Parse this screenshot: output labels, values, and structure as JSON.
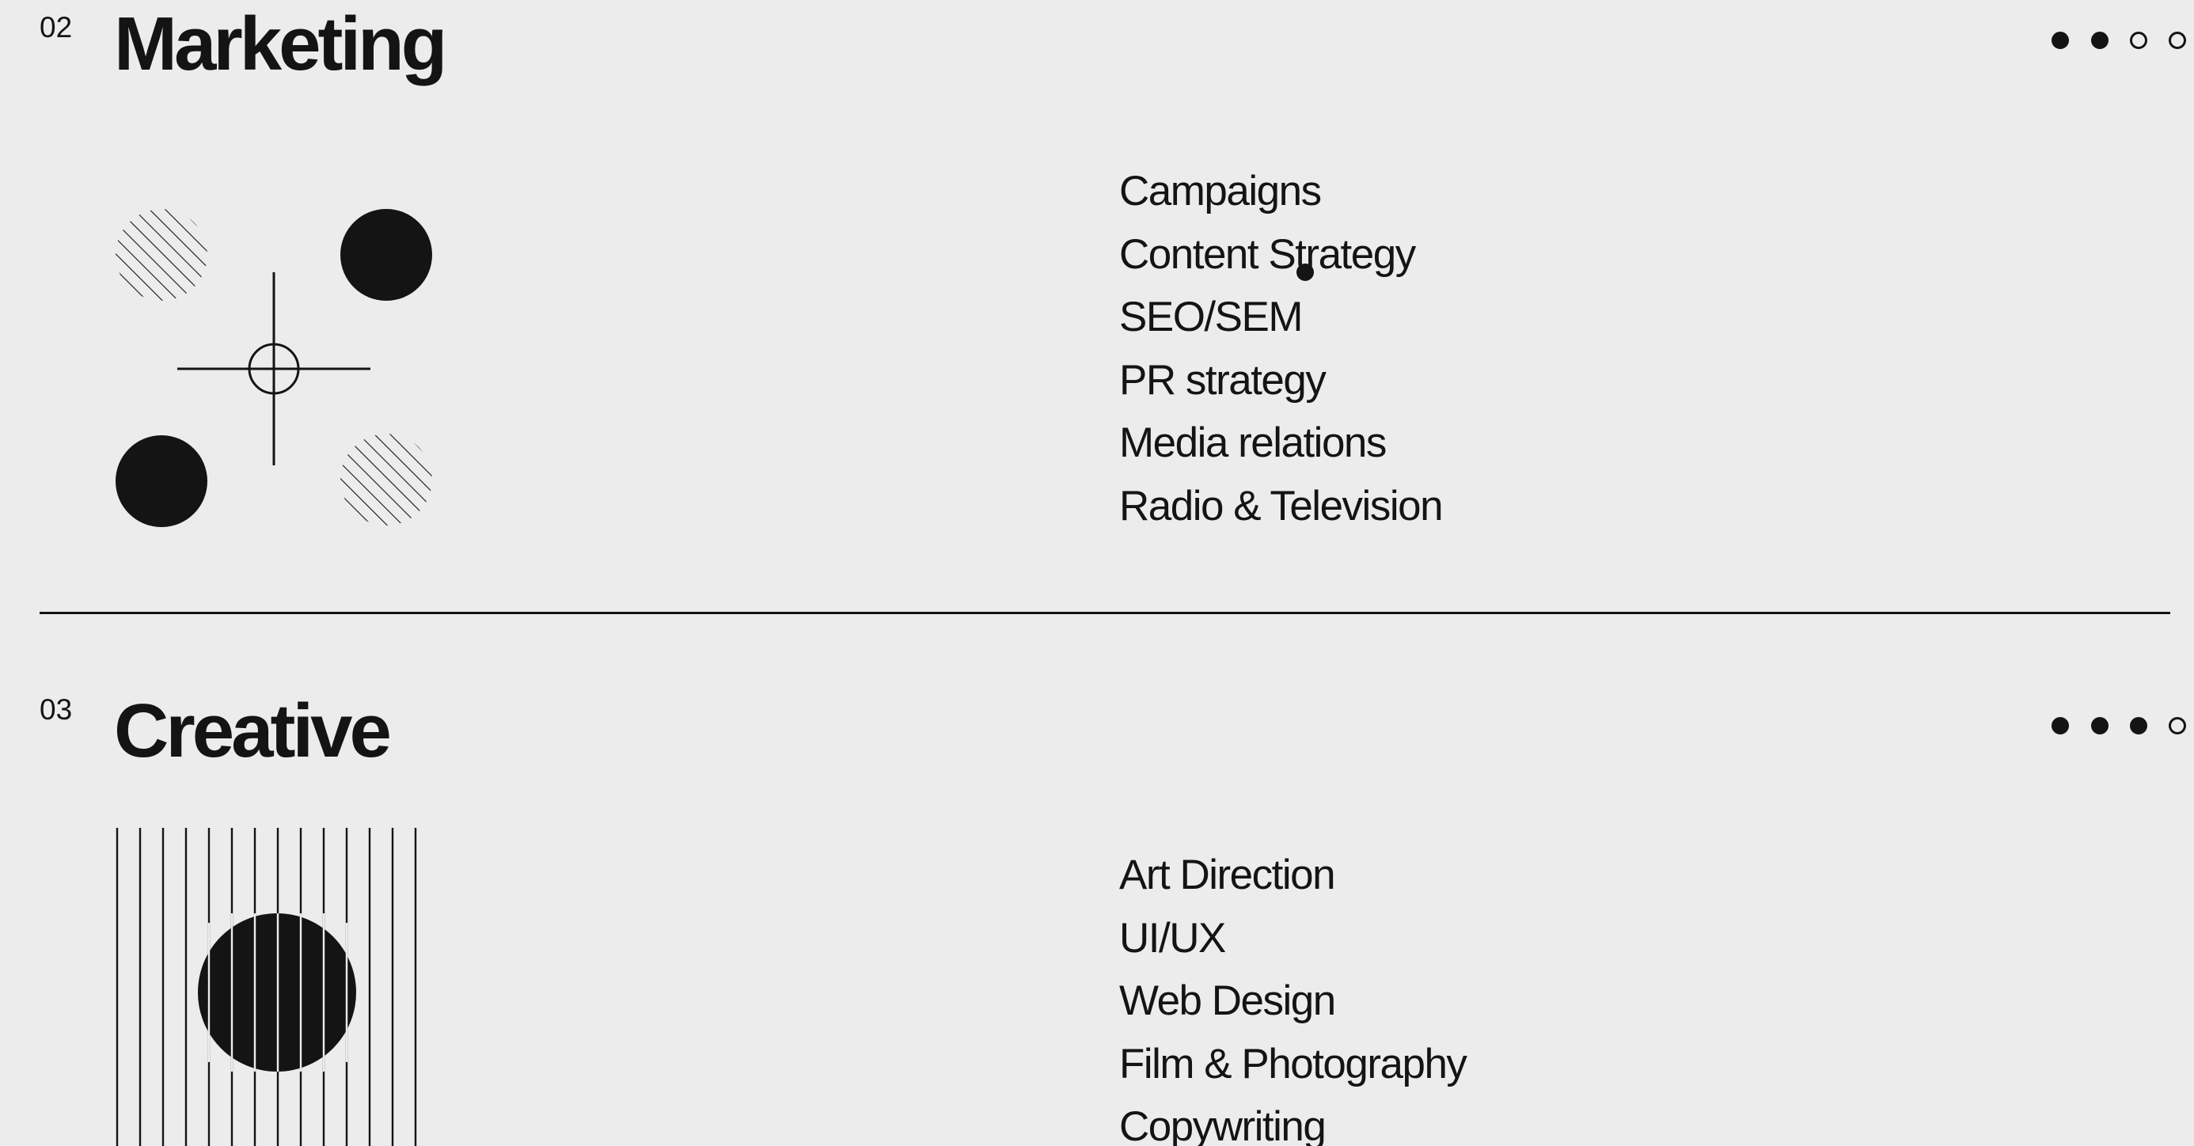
{
  "sections": [
    {
      "number": "02",
      "title": "Marketing",
      "progress": {
        "filled": 2,
        "total": 4
      },
      "items": [
        "Campaigns",
        "Content Strategy",
        "SEO/SEM",
        "PR strategy",
        "Media relations",
        "Radio & Television"
      ],
      "illustration": "crosshair-circles-icon"
    },
    {
      "number": "03",
      "title": "Creative",
      "progress": {
        "filled": 3,
        "total": 4
      },
      "items": [
        "Art Direction",
        "UI/UX",
        "Web Design",
        "Film & Photography",
        "Copywriting"
      ],
      "illustration": "striped-circle-icon"
    }
  ],
  "colors": {
    "background": "#ececec",
    "ink": "#141414"
  }
}
